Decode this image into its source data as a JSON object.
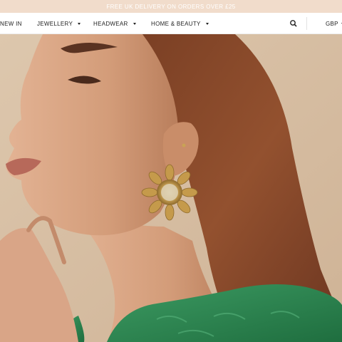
{
  "promo": {
    "text": "FREE UK DELIVERY ON ORDERS OVER £25"
  },
  "nav": {
    "items": [
      {
        "label": "NEW IN",
        "has_dropdown": false
      },
      {
        "label": "JEWELLERY",
        "has_dropdown": true
      },
      {
        "label": "HEADWEAR",
        "has_dropdown": true
      },
      {
        "label": "HOME & BEAUTY",
        "has_dropdown": true
      }
    ],
    "search_icon": "search-icon",
    "currency": {
      "label": "GBP",
      "has_dropdown": true
    }
  },
  "hero": {
    "subject": "woman-wearing-sunflower-earring"
  },
  "colors": {
    "promo_bar": "#f1dccb",
    "promo_text": "#ffffff",
    "nav_text": "#222222",
    "backdrop": "#d9c2a6",
    "hair": "#8a4a2c",
    "skin": "#d7a07e",
    "blouse": "#2f8a52",
    "earring_gold": "#c9a255"
  }
}
